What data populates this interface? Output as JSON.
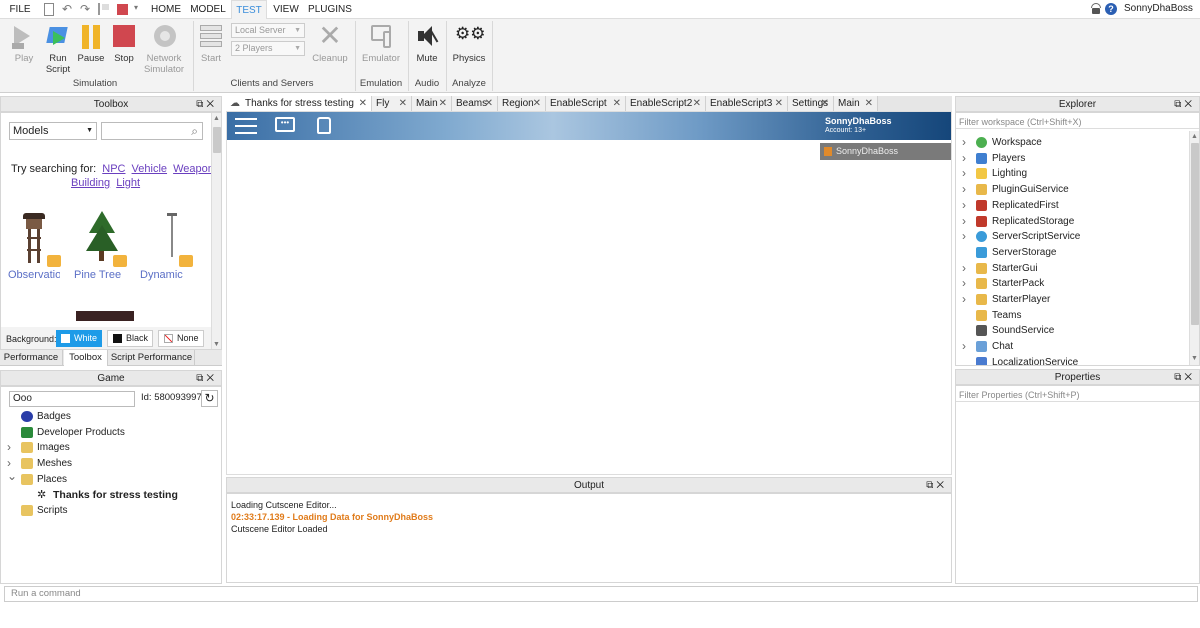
{
  "menubar": {
    "items": [
      "FILE",
      "HOME",
      "MODEL",
      "TEST",
      "VIEW",
      "PLUGINS"
    ],
    "active": "TEST",
    "username": "SonnyDhaBoss"
  },
  "ribbon": {
    "simulation": {
      "buttons": [
        {
          "label": "Play",
          "icon": "play-icon",
          "disabled": true
        },
        {
          "label": "Run\nScript",
          "icon": "run-script-icon",
          "disabled": false
        },
        {
          "label": "Pause",
          "icon": "pause-icon",
          "disabled": false
        },
        {
          "label": "Stop",
          "icon": "stop-icon",
          "disabled": false
        },
        {
          "label": "Network\nSimulator",
          "icon": "network-simulator-icon",
          "disabled": true
        }
      ],
      "group_label": "Simulation"
    },
    "clients": {
      "start_label": "Start",
      "server_value": "Local Server",
      "players_value": "2 Players",
      "cleanup_label": "Cleanup",
      "group_label": "Clients and Servers"
    },
    "emulation": {
      "button_label": "Emulator",
      "group_label": "Emulation"
    },
    "audio": {
      "button_label": "Mute",
      "group_label": "Audio"
    },
    "analyze": {
      "button_label": "Physics",
      "group_label": "Analyze"
    }
  },
  "toolbox": {
    "title": "Toolbox",
    "category": "Models",
    "search_placeholder": "",
    "try_label": "Try searching for:",
    "suggestions": [
      "NPC",
      "Vehicle",
      "Weapon",
      "Building",
      "Light"
    ],
    "items": [
      {
        "name": "Observatio",
        "icon": "observation-tower-icon"
      },
      {
        "name": "Pine Tree",
        "icon": "pine-tree-icon"
      },
      {
        "name": "Dynamic",
        "icon": "dynamic-light-icon"
      }
    ],
    "background_label": "Background:",
    "bg_options": [
      "White",
      "Black",
      "None"
    ],
    "bg_selected": "White",
    "bottom_tabs": [
      "Performance",
      "Toolbox",
      "Script Performance"
    ]
  },
  "game": {
    "title": "Game",
    "search_value": "Ooo",
    "id_label": "Id: 580093997",
    "items": [
      {
        "label": "Badges",
        "icon": "badge-icon",
        "expandable": false,
        "indent": 0
      },
      {
        "label": "Developer Products",
        "icon": "developer-products-icon",
        "expandable": false,
        "indent": 0
      },
      {
        "label": "Images",
        "icon": "folder-icon",
        "expandable": true,
        "indent": 0
      },
      {
        "label": "Meshes",
        "icon": "folder-icon",
        "expandable": true,
        "indent": 0
      },
      {
        "label": "Places",
        "icon": "folder-icon",
        "expandable": true,
        "expanded": true,
        "indent": 0
      },
      {
        "label": "Thanks for stress testing",
        "icon": "gear-icon",
        "expandable": false,
        "indent": 1,
        "bold": true
      },
      {
        "label": "Scripts",
        "icon": "folder-icon",
        "expandable": false,
        "indent": 0
      }
    ]
  },
  "tabs": [
    {
      "label": "Thanks for stress testing",
      "active": true
    },
    {
      "label": "Fly"
    },
    {
      "label": "Main"
    },
    {
      "label": "Beams"
    },
    {
      "label": "Region"
    },
    {
      "label": "EnableScript"
    },
    {
      "label": "EnableScript2"
    },
    {
      "label": "EnableScript3"
    },
    {
      "label": "Settings"
    },
    {
      "label": "Main"
    }
  ],
  "viewport": {
    "player_name": "SonnyDhaBoss",
    "account": "Account: 13+",
    "player_list_entry": "SonnyDhaBoss"
  },
  "explorer": {
    "title": "Explorer",
    "filter_placeholder": "Filter workspace (Ctrl+Shift+X)",
    "items": [
      {
        "label": "Workspace",
        "icon": "workspace-icon",
        "expandable": true,
        "color": "#4caf50"
      },
      {
        "label": "Players",
        "icon": "players-icon",
        "expandable": true,
        "color": "#3f7fd0"
      },
      {
        "label": "Lighting",
        "icon": "lighting-icon",
        "expandable": true,
        "color": "#f2c744"
      },
      {
        "label": "PluginGuiService",
        "icon": "plugin-gui-icon",
        "expandable": true,
        "color": "#e8b84a"
      },
      {
        "label": "ReplicatedFirst",
        "icon": "replicated-first-icon",
        "expandable": true,
        "color": "#c0392b"
      },
      {
        "label": "ReplicatedStorage",
        "icon": "replicated-storage-icon",
        "expandable": true,
        "color": "#c0392b"
      },
      {
        "label": "ServerScriptService",
        "icon": "server-script-icon",
        "expandable": true,
        "color": "#3a9bd9"
      },
      {
        "label": "ServerStorage",
        "icon": "server-storage-icon",
        "expandable": false,
        "color": "#3a9bd9"
      },
      {
        "label": "StarterGui",
        "icon": "starter-gui-icon",
        "expandable": true,
        "color": "#e8b84a"
      },
      {
        "label": "StarterPack",
        "icon": "starter-pack-icon",
        "expandable": true,
        "color": "#e8b84a"
      },
      {
        "label": "StarterPlayer",
        "icon": "starter-player-icon",
        "expandable": true,
        "color": "#e8b84a"
      },
      {
        "label": "Teams",
        "icon": "teams-icon",
        "expandable": false,
        "color": "#e8b84a"
      },
      {
        "label": "SoundService",
        "icon": "sound-service-icon",
        "expandable": false,
        "color": "#555555"
      },
      {
        "label": "Chat",
        "icon": "chat-icon",
        "expandable": true,
        "color": "#6aa0d8"
      },
      {
        "label": "LocalizationService",
        "icon": "localization-icon",
        "expandable": false,
        "color": "#4a7bd0"
      }
    ]
  },
  "properties": {
    "title": "Properties",
    "filter_placeholder": "Filter Properties (Ctrl+Shift+P)"
  },
  "output": {
    "title": "Output",
    "lines": [
      {
        "text": "Loading Cutscene Editor...",
        "color": "#222222"
      },
      {
        "text": "02:33:17.139 - Loading Data for SonnyDhaBoss",
        "color": "#e07b1a"
      },
      {
        "text": "Cutscene Editor Loaded",
        "color": "#222222"
      }
    ]
  },
  "command_bar": {
    "placeholder": "Run a command"
  }
}
